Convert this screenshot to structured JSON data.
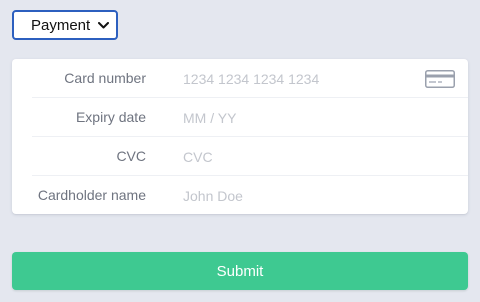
{
  "payment_select": {
    "selected_value": "Payment"
  },
  "card_form": {
    "card_number": {
      "label": "Card number",
      "placeholder": "1234 1234 1234 1234",
      "value": ""
    },
    "expiry_date": {
      "label": "Expiry date",
      "placeholder": "MM / YY",
      "value": ""
    },
    "cvc": {
      "label": "CVC",
      "placeholder": "CVC",
      "value": ""
    },
    "cardholder_name": {
      "label": "Cardholder name",
      "placeholder": "John Doe",
      "value": ""
    },
    "card_icon": "credit-card-icon"
  },
  "submit": {
    "label": "Submit"
  },
  "colors": {
    "page_background": "#e4e7ef",
    "select_border": "#2c5fbf",
    "label_text": "#6f7480",
    "placeholder_text": "#c3c6cd",
    "submit_background": "#3ec991",
    "submit_text": "#ffffff"
  }
}
